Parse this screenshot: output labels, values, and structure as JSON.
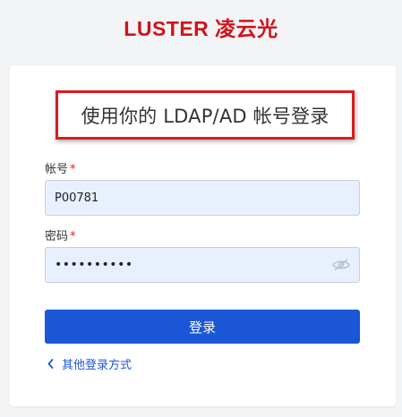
{
  "logo": {
    "text": "LUSTER 凌云光"
  },
  "login": {
    "title": "使用你的 LDAP/AD 帐号登录",
    "account_label": "帐号",
    "account_value": "P00781",
    "required_mark": "*",
    "password_label": "密码",
    "password_value": "••••••••••",
    "submit_label": "登录",
    "other_methods_label": "其他登录方式"
  },
  "colors": {
    "brand": "#d0121b",
    "primary": "#1a56d6",
    "input_bg": "#e8f0fe",
    "highlight_border": "#d91c1c"
  },
  "icons": {
    "password_toggle": "eye-off-icon",
    "back": "chevron-left-icon"
  }
}
